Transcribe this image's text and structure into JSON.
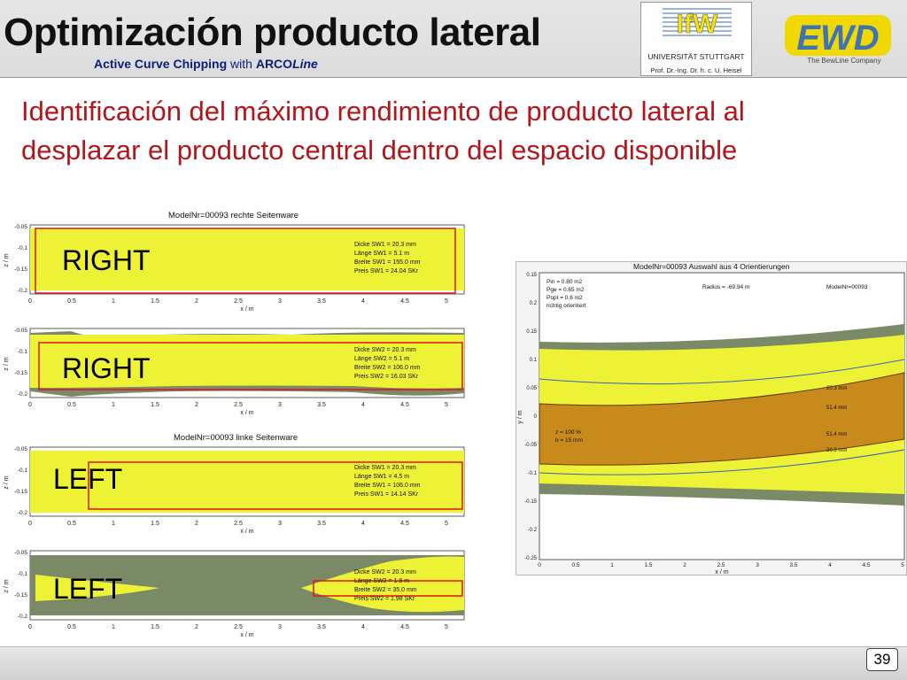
{
  "header": {
    "title": "Optimización producto lateral",
    "subtitle_bold": "Active Curve Chipping",
    "subtitle_with": " with ",
    "subtitle_brand": "ARCO",
    "subtitle_brand_italic": "Line"
  },
  "logos": {
    "ifw_text": "IfW",
    "ifw_university": "UNIVERSITÄT STUTTGART",
    "ifw_professor": "Prof. Dr.-Ing. Dr. h. c. U. Heisel",
    "ewd_text": "EWD",
    "ewd_tagline": "The BewLine Company"
  },
  "heading": "Identificación del máximo rendimiento de producto lateral al desplazar el producto central dentro del espacio disponible",
  "right_panel_title": "ModelNr=00093 rechte Seitenware",
  "left_panel_title": "ModelNr=00093 linke Seitenware",
  "orient_panel_title": "ModelNr=00093  Auswahl aus 4 Orientierungen",
  "labels": {
    "right_1": "RIGHT",
    "right_2": "RIGHT",
    "left_1": "LEFT",
    "left_2": "LEFT"
  },
  "axis": {
    "x_label": "x / m",
    "z_label": "z / m",
    "y_label": "y / m",
    "x_ticks": [
      "0",
      "0.5",
      "1",
      "1.5",
      "2",
      "2.5",
      "3",
      "3.5",
      "4",
      "4.5",
      "5"
    ],
    "z_ticks": [
      "-0.05",
      "-0.1",
      "-0.15",
      "-0.2"
    ]
  },
  "info": {
    "r1": [
      "Dicke SW1 = 20.3 mm",
      "Länge SW1 = 5.1 m",
      "Breite SW1 = 155.0 mm",
      "Preis  SW1 = 24.04 SKr"
    ],
    "r2": [
      "Dicke SW2 = 20.3 mm",
      "Länge SW2 = 5.1 m",
      "Breite SW2 = 106.0 mm",
      "Preis  SW2 = 16.03 SKr"
    ],
    "l1": [
      "Dicke SW1 = 20.3 mm",
      "Länge SW1 = 4.5 m",
      "Breite SW1 = 106.0 mm",
      "Preis  SW1 = 14.14 SKr"
    ],
    "l2": [
      "Dicke SW2 = 20.3 mm",
      "Länge SW2 = 1.8 m",
      "Breite SW2 = 35.0 mm",
      "Preis  SW2 = 1.98 SKr"
    ]
  },
  "orient": {
    "stats": [
      "Pin  =    0.80  m2",
      "Pge  =    0.65  m2",
      "Popt =    0.6    m2",
      "richtig orientiert"
    ],
    "radius": "Radius = -69.94 m",
    "model": "ModelNr=00093",
    "y_ticks": [
      "0.15",
      "0.2",
      "0.15",
      "0.1",
      "0.05",
      "0",
      "-0.05",
      "-0.1",
      "-0.15",
      "-0.2",
      "-0.25"
    ],
    "x_ticks": [
      "0",
      "0.5",
      "1",
      "1.5",
      "2",
      "2.5",
      "3",
      "3.5",
      "4",
      "4.5",
      "5"
    ],
    "central": [
      "z  =  100  %",
      "b  =   15  mm"
    ],
    "annotations": [
      "20.3 mm",
      "51.4 mm",
      "51.4 mm",
      "20.3 mm"
    ]
  },
  "page_number": "39",
  "colors": {
    "title": "#111111",
    "subtitle": "#0a1e7a",
    "heading": "#b2161b",
    "log_yellow": "#eef235",
    "log_green": "#7a8a66",
    "central_brown": "#c98a1c",
    "frame_red": "#e0161b"
  }
}
